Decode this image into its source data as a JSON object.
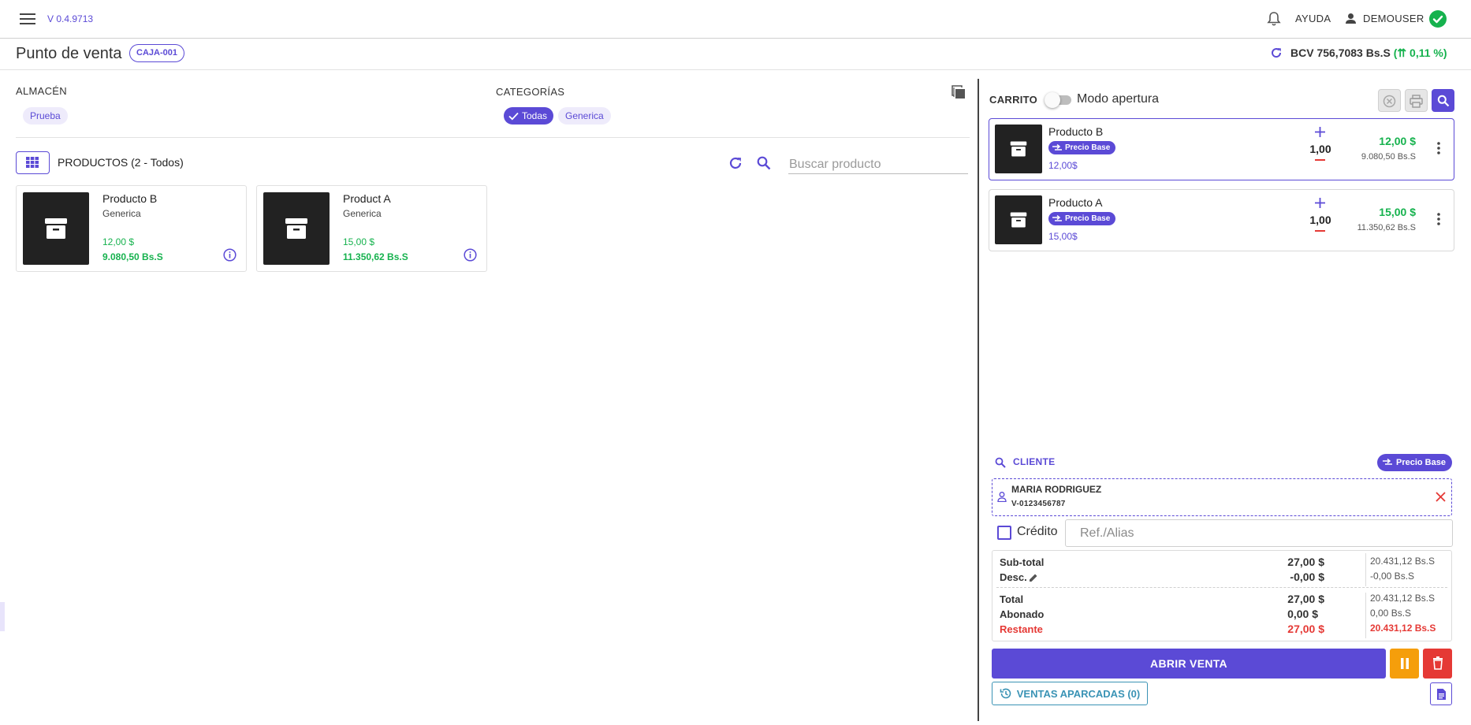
{
  "topbar": {
    "version": "V 0.4.9713",
    "help_label": "AYUDA",
    "user_label": "DEMOUSER"
  },
  "header": {
    "title": "Punto de venta",
    "caja": "CAJA-001",
    "bcv_rate": "BCV 756,7083 Bs.S",
    "bcv_change": "(⇈ 0,11 %)"
  },
  "filters": {
    "almacen_label": "ALMACÉN",
    "almacen_chips": [
      "Prueba"
    ],
    "categorias_label": "CATEGORÍAS",
    "categorias_chips": [
      "Todas",
      "Generica"
    ],
    "selected_category": "Todas"
  },
  "products": {
    "header": "PRODUCTOS (2 - Todos)",
    "search_placeholder": "Buscar producto",
    "items": [
      {
        "name": "Producto B",
        "category": "Generica",
        "price_usd": "12,00 $",
        "price_bs": "9.080,50 Bs.S"
      },
      {
        "name": "Product A",
        "category": "Generica",
        "price_usd": "15,00 $",
        "price_bs": "11.350,62 Bs.S"
      }
    ]
  },
  "cart": {
    "title": "CARRITO",
    "mode_label": "Modo apertura",
    "mode_on": false,
    "items": [
      {
        "name": "Producto B",
        "tag": "Precio Base",
        "unit_price": "12,00$",
        "qty": "1,00",
        "total_usd": "12,00 $",
        "total_bs": "9.080,50 Bs.S"
      },
      {
        "name": "Producto A",
        "tag": "Precio Base",
        "unit_price": "15,00$",
        "qty": "1,00",
        "total_usd": "15,00 $",
        "total_bs": "11.350,62 Bs.S"
      }
    ]
  },
  "client": {
    "label": "CLIENTE",
    "price_badge": "Precio Base",
    "name": "MARIA RODRIGUEZ",
    "id": "V-0123456787"
  },
  "credit": {
    "label": "Crédito",
    "checked": false,
    "ref_placeholder": "Ref./Alias"
  },
  "totals": {
    "subtotal_label": "Sub-total",
    "subtotal_usd": "27,00 $",
    "subtotal_bs": "20.431,12 Bs.S",
    "desc_label": "Desc.",
    "desc_usd": "-0,00 $",
    "desc_bs": "-0,00 Bs.S",
    "total_label": "Total",
    "total_usd": "27,00 $",
    "total_bs": "20.431,12 Bs.S",
    "abonado_label": "Abonado",
    "abonado_usd": "0,00 $",
    "abonado_bs": "0,00 Bs.S",
    "restante_label": "Restante",
    "restante_usd": "27,00 $",
    "restante_bs": "20.431,12 Bs.S"
  },
  "actions": {
    "open_sale": "ABRIR VENTA",
    "parked": "VENTAS APARCADAS (0)"
  },
  "colors": {
    "primary": "#5b4ad6",
    "success": "#16b24e",
    "danger": "#e53935",
    "warning": "#f59e0b",
    "info": "#3a93b5"
  }
}
